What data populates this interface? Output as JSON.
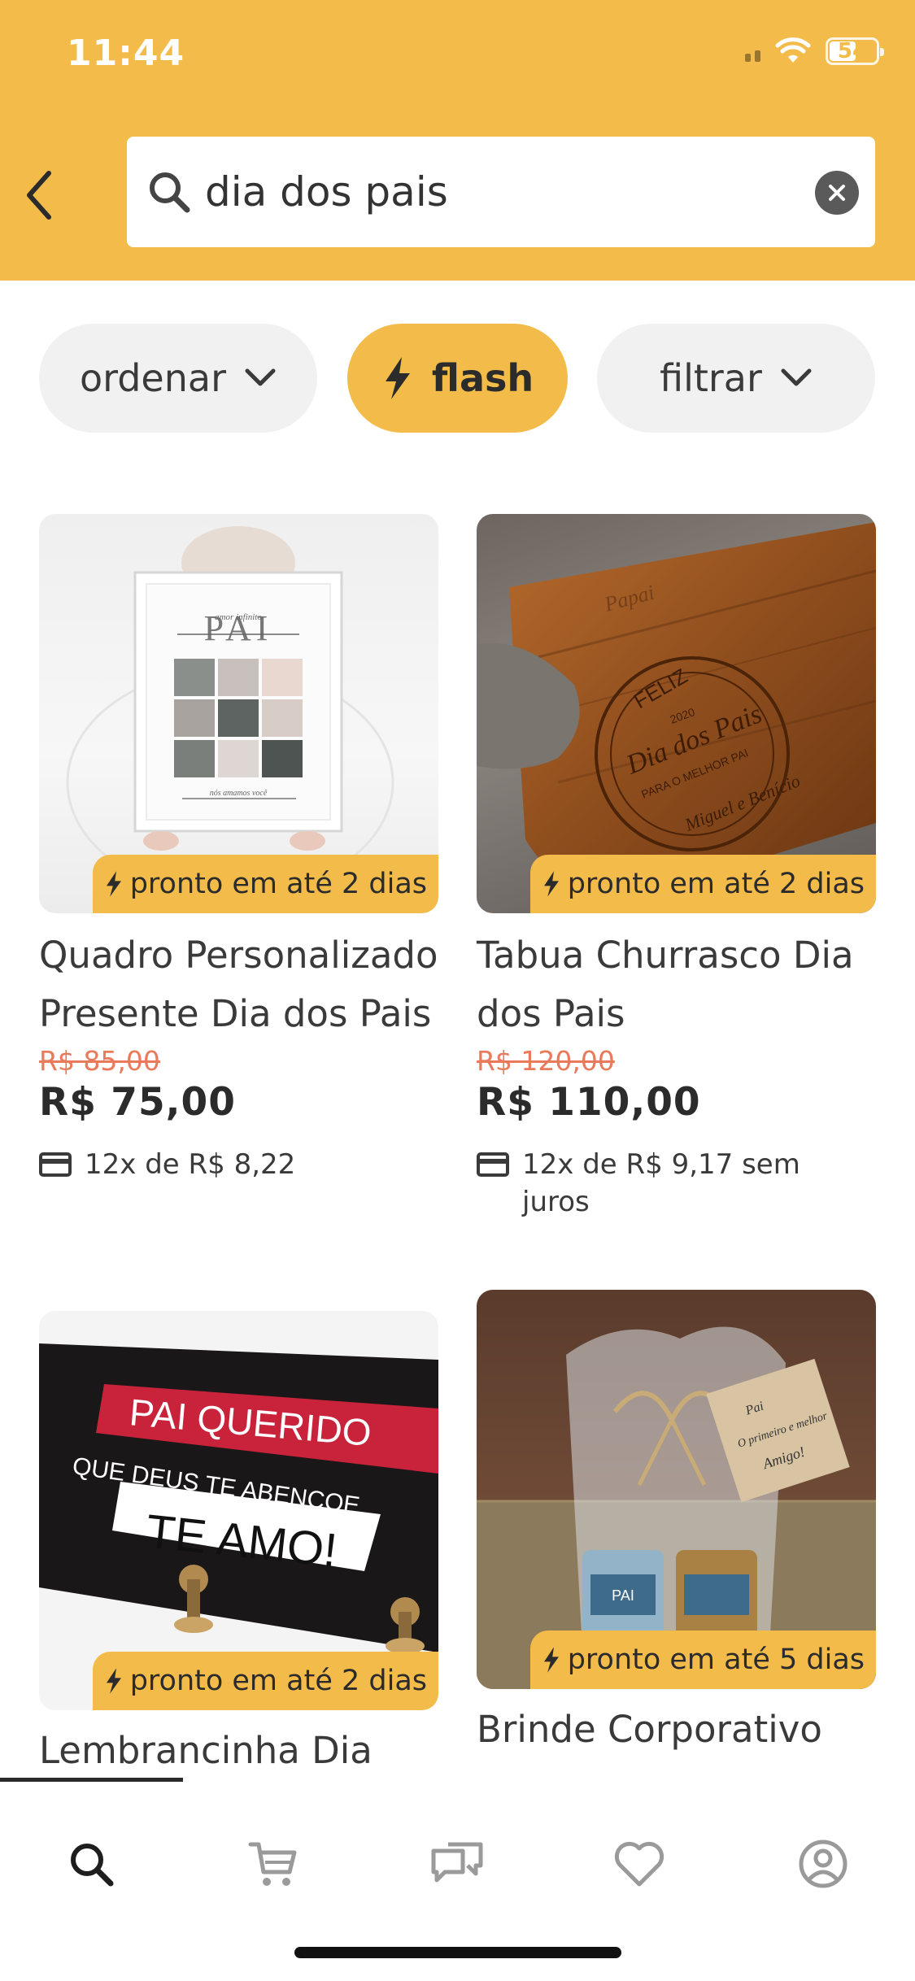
{
  "status_bar": {
    "time": "11:44",
    "battery": "54"
  },
  "search": {
    "value": "dia dos pais",
    "placeholder": ""
  },
  "filters": {
    "sort_label": "ordenar",
    "flash_label": "flash",
    "filter_label": "filtrar"
  },
  "colors": {
    "brand": "#f3bc4a",
    "old_price": "#e97a5b",
    "chip_bg": "#f1f1f1"
  },
  "products": [
    {
      "badge": "pronto em até 2 dias",
      "title": "Quadro Personalizado Presente Dia dos Pais",
      "old_price": "R$ 85,00",
      "price": "R$ 75,00",
      "installments": "12x de R$ 8,22",
      "image_title": "PAI",
      "image_subtitle": "amor infinito",
      "image_footer": "nós amamos você"
    },
    {
      "badge": "pronto em até 2 dias",
      "title": "Tabua Churrasco Dia dos Pais",
      "old_price": "R$ 120,00",
      "price": "R$ 110,00",
      "installments": "12x de R$ 9,17 sem juros",
      "image_line1": "FELIZ",
      "image_line2": "2020",
      "image_line3": "Dia dos Pais",
      "image_line4": "PARA O MELHOR PAI",
      "image_line5": "Miguel e Benício",
      "image_line6": "Papai"
    },
    {
      "badge": "pronto em até 2 dias",
      "title": "Lembrancinha Dia",
      "image_line1": "PAI QUERIDO",
      "image_line2": "QUE DEUS TE ABENÇOE",
      "image_line3": "TE AMO!"
    },
    {
      "badge": "pronto em até 5 dias",
      "title": "Brinde Corporativo",
      "image_tag1": "Pai",
      "image_tag2": "O primeiro e melhor",
      "image_tag3": "Amigo!",
      "image_label": "PAI"
    }
  ],
  "nav": {
    "items": [
      "search-icon",
      "cart-icon",
      "chat-icon",
      "heart-icon",
      "profile-icon"
    ]
  }
}
